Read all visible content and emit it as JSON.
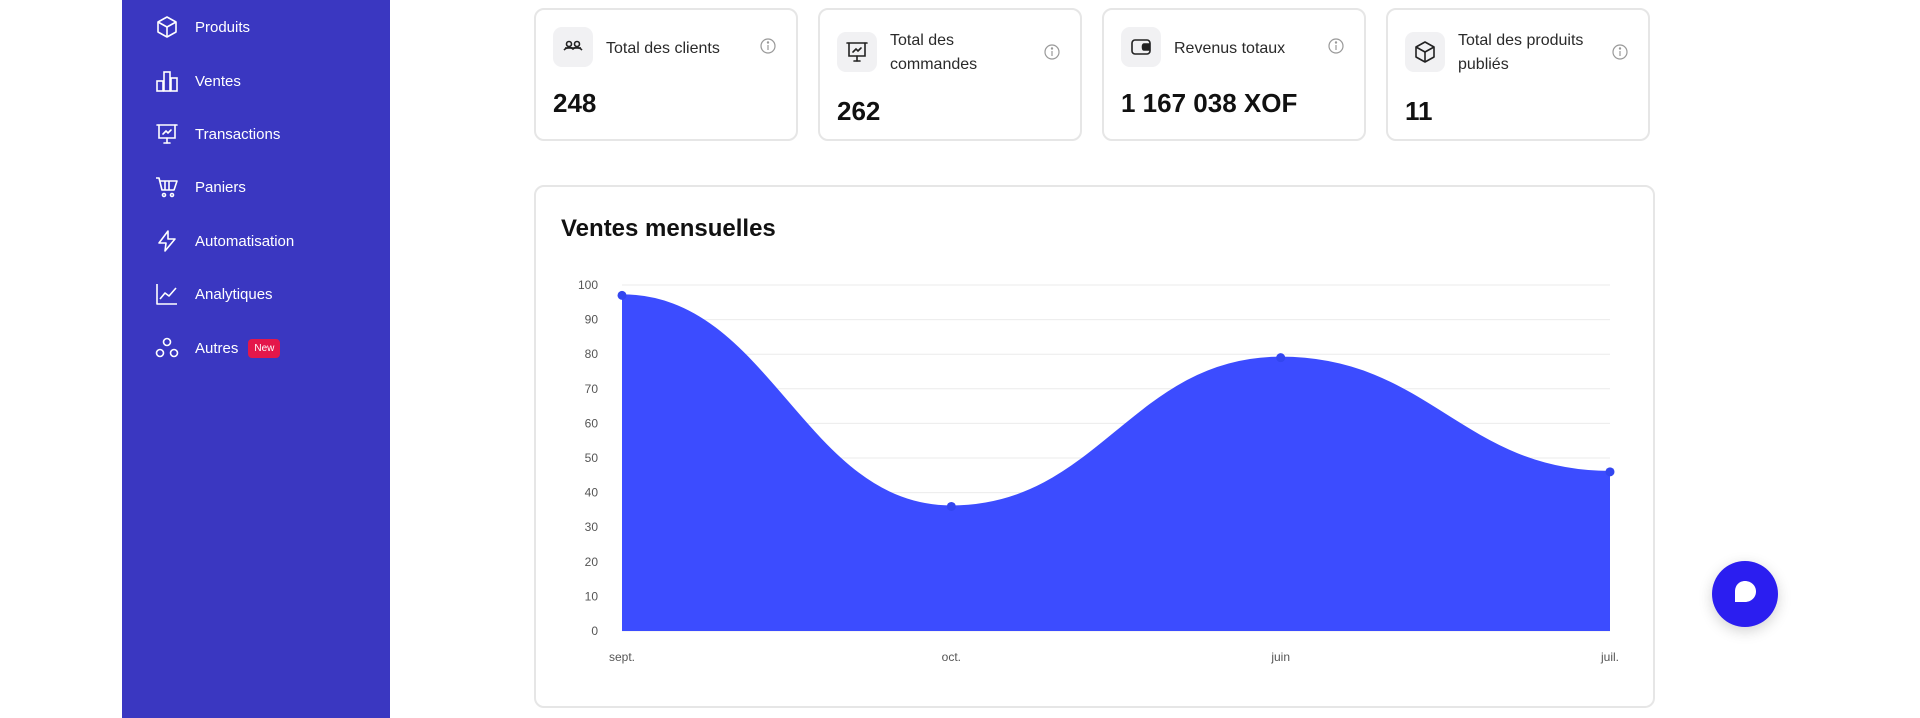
{
  "sidebar": {
    "items": [
      {
        "label": "Produits",
        "icon": "box-icon"
      },
      {
        "label": "Ventes",
        "icon": "bar-chart-icon"
      },
      {
        "label": "Transactions",
        "icon": "presentation-icon"
      },
      {
        "label": "Paniers",
        "icon": "cart-icon"
      },
      {
        "label": "Automatisation",
        "icon": "lightning-icon"
      },
      {
        "label": "Analytiques",
        "icon": "line-chart-icon"
      },
      {
        "label": "Autres",
        "icon": "circles-icon",
        "badge": "New"
      }
    ]
  },
  "cards": [
    {
      "title": "Total des clients",
      "value": "248",
      "icon": "users-icon"
    },
    {
      "title_line1": "Total des",
      "title_line2": "commandes",
      "value": "262",
      "icon": "presentation-icon"
    },
    {
      "title": "Revenus totaux",
      "value": "1 167 038 XOF",
      "icon": "wallet-icon"
    },
    {
      "title_line1": "Total des produits",
      "title_line2": "publiés",
      "value": "11",
      "icon": "box-icon"
    }
  ],
  "chart": {
    "title": "Ventes mensuelles"
  },
  "chart_data": {
    "type": "area",
    "categories": [
      "sept.",
      "oct.",
      "juin",
      "juil."
    ],
    "values": [
      97,
      36,
      79,
      46
    ],
    "ylim": [
      0,
      100
    ],
    "yticks": [
      0,
      10,
      20,
      30,
      40,
      50,
      60,
      70,
      80,
      90,
      100
    ],
    "grid": true,
    "color": "#3c4cff"
  },
  "colors": {
    "sidebar": "#3a37c1",
    "badge": "#e4174a",
    "chat": "#2b1ef0"
  }
}
